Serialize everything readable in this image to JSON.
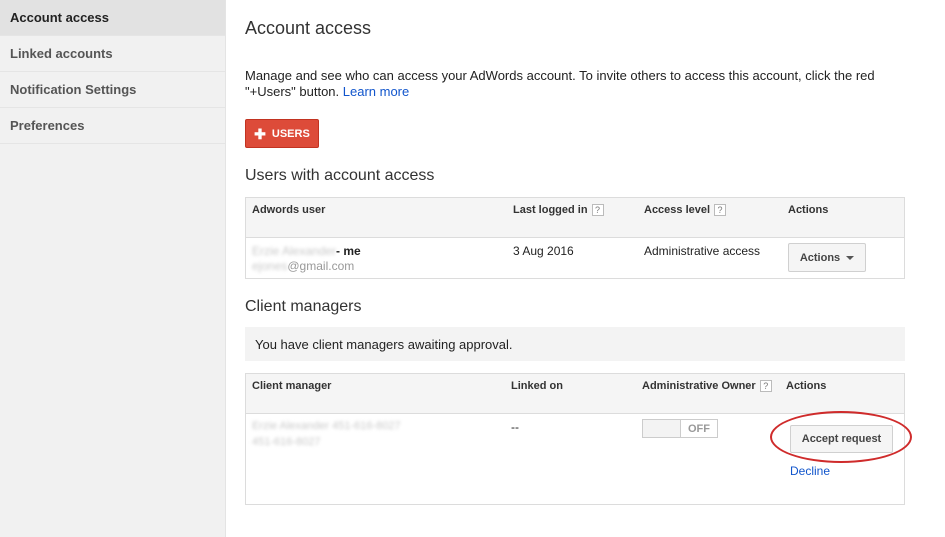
{
  "sidebar": {
    "items": [
      {
        "label": "Account access",
        "active": true
      },
      {
        "label": "Linked accounts"
      },
      {
        "label": "Notification Settings"
      },
      {
        "label": "Preferences"
      }
    ]
  },
  "page": {
    "title": "Account access",
    "intro_text": "Manage and see who can access your AdWords account. To invite others to access this account, click the red \"+Users\" button.",
    "learn_more": "Learn more",
    "users_button": "USERS",
    "users_button_icon": "plus-icon"
  },
  "users_section": {
    "title": "Users with account access",
    "columns": {
      "user": "Adwords user",
      "last_logged": "Last logged in",
      "access": "Access level",
      "actions": "Actions"
    },
    "help_glyph": "?",
    "rows": [
      {
        "name_redacted": "Erzie Alexander",
        "me_suffix": "- me",
        "email_redacted": "ejones",
        "email_domain": "@gmail.com",
        "last_logged": "3 Aug 2016",
        "access": "Administrative access",
        "actions_button": "Actions"
      }
    ]
  },
  "client_section": {
    "title": "Client managers",
    "notice": "You have client managers awaiting approval.",
    "columns": {
      "manager": "Client manager",
      "linked_on": "Linked on",
      "admin_owner": "Administrative Owner",
      "actions": "Actions"
    },
    "rows": [
      {
        "manager_line1_redacted": "Erzie Alexander 451-616-8027",
        "manager_line2_redacted": "451-616-8027",
        "linked_on": "--",
        "toggle_label": "OFF",
        "accept_button": "Accept request",
        "decline_link": "Decline"
      }
    ]
  },
  "colors": {
    "accent_red": "#dd4b39",
    "link_blue": "#1155cc",
    "annotation_red": "#cf2b2b"
  }
}
